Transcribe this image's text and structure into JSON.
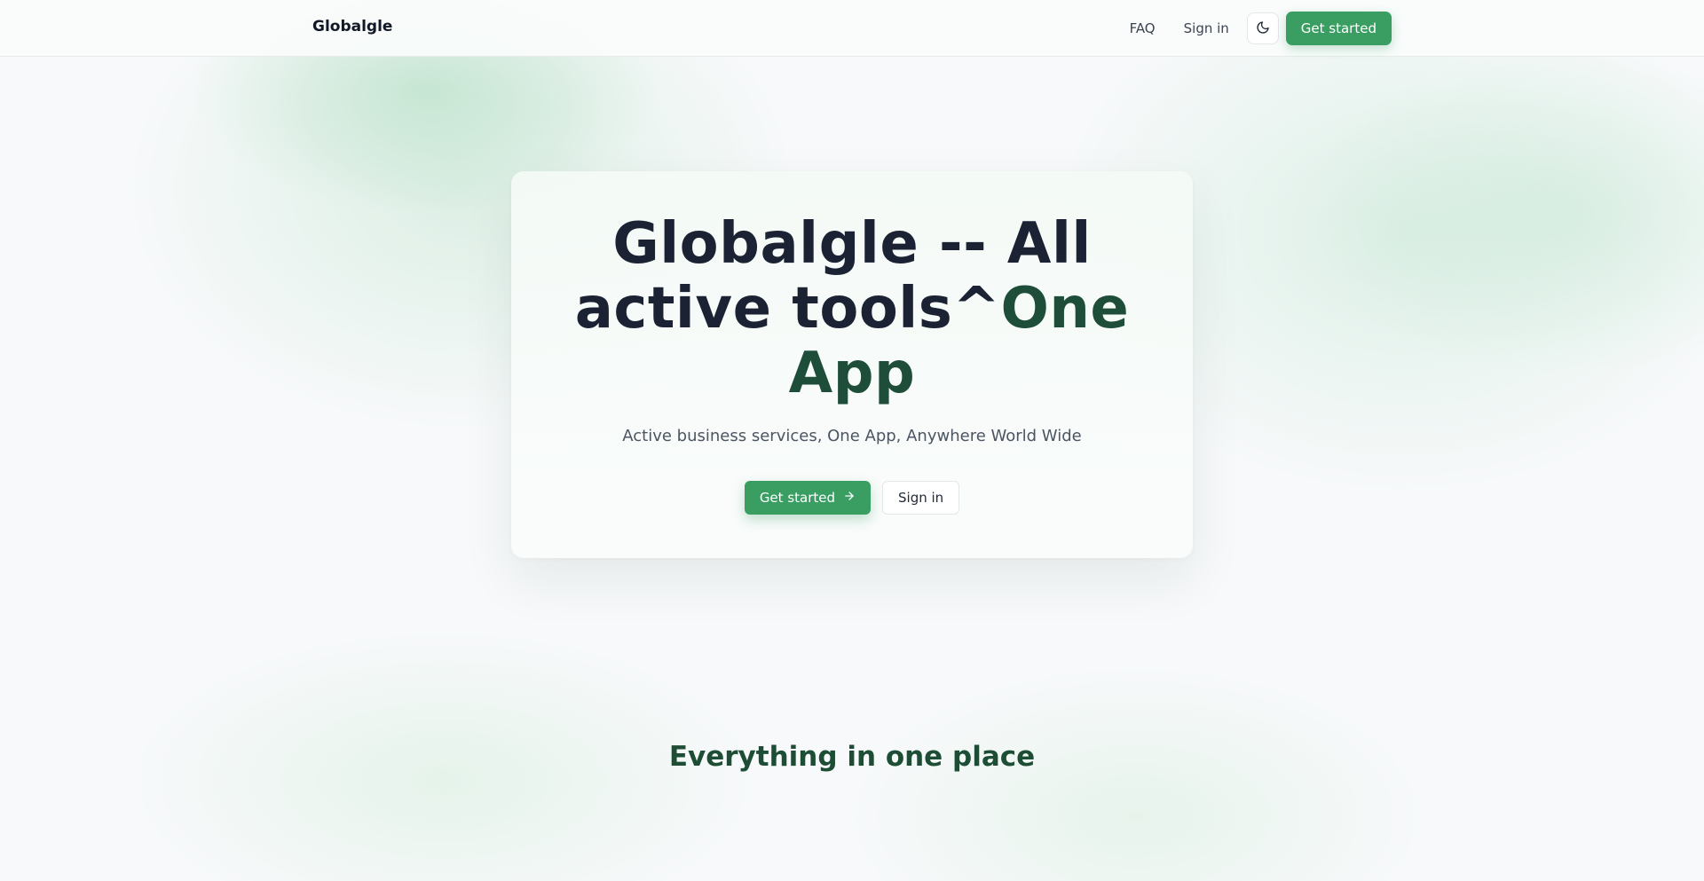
{
  "nav": {
    "brand": "Globalgle",
    "faq_label": "FAQ",
    "signin_label": "Sign in",
    "theme_icon": "moon-icon",
    "cta_label": "Get started"
  },
  "hero": {
    "title_line1": "Globalgle -- All",
    "title_line2_main": "active tools^",
    "title_line2_accent": "One",
    "title_line3_accent": "App",
    "subtitle": "Active business services, One App, Anywhere World Wide",
    "primary_label": "Get started",
    "primary_icon": "arrow-right-icon",
    "secondary_label": "Sign in"
  },
  "features": {
    "title": "Everything in one place"
  },
  "colors": {
    "accent": "#3a9e63",
    "title_accent": "#1e4d3a",
    "section_title": "#1d4d34"
  }
}
